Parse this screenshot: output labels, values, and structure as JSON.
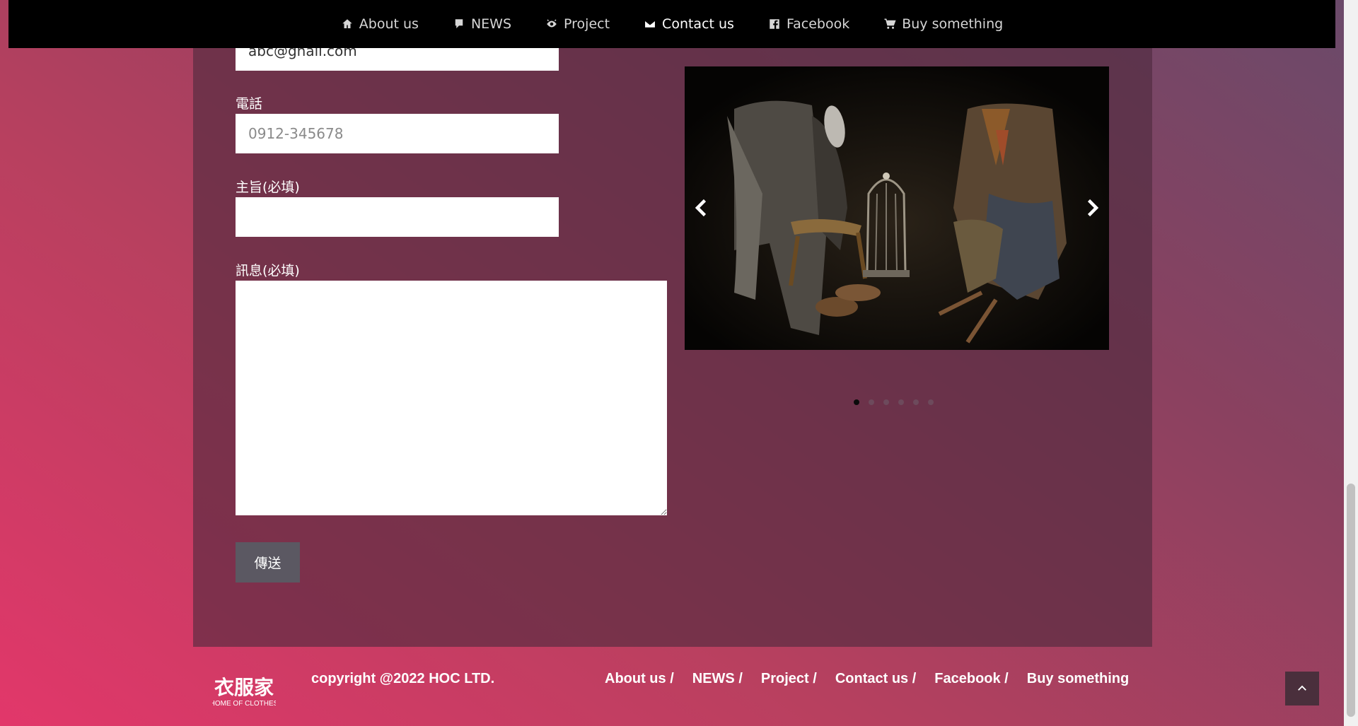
{
  "nav": {
    "items": [
      {
        "label": "About us",
        "icon": "home-icon"
      },
      {
        "label": "NEWS",
        "icon": "speech-bubble-icon"
      },
      {
        "label": "Project",
        "icon": "eye-icon"
      },
      {
        "label": "Contact us",
        "icon": "envelope-icon",
        "active": true
      },
      {
        "label": "Facebook",
        "icon": "facebook-icon"
      },
      {
        "label": "Buy something",
        "icon": "cart-icon"
      }
    ]
  },
  "form": {
    "email_value": "abc@gnail.com",
    "phone_label": "電話",
    "phone_placeholder": "0912-345678",
    "subject_label": "主旨(必填)",
    "message_label": "訊息(必填)",
    "send_label": "傳送"
  },
  "carousel": {
    "prev_icon": "chevron-left-icon",
    "next_icon": "chevron-right-icon",
    "slide_count": 6,
    "active_slide": 1
  },
  "footer": {
    "logo_text": "衣服家",
    "logo_sub": "HOME OF CLOTHES",
    "copyright": "copyright @2022 HOC LTD.",
    "links": [
      "About us /",
      "NEWS /",
      "Project /",
      "Contact us /",
      "Facebook /",
      "Buy something"
    ]
  }
}
